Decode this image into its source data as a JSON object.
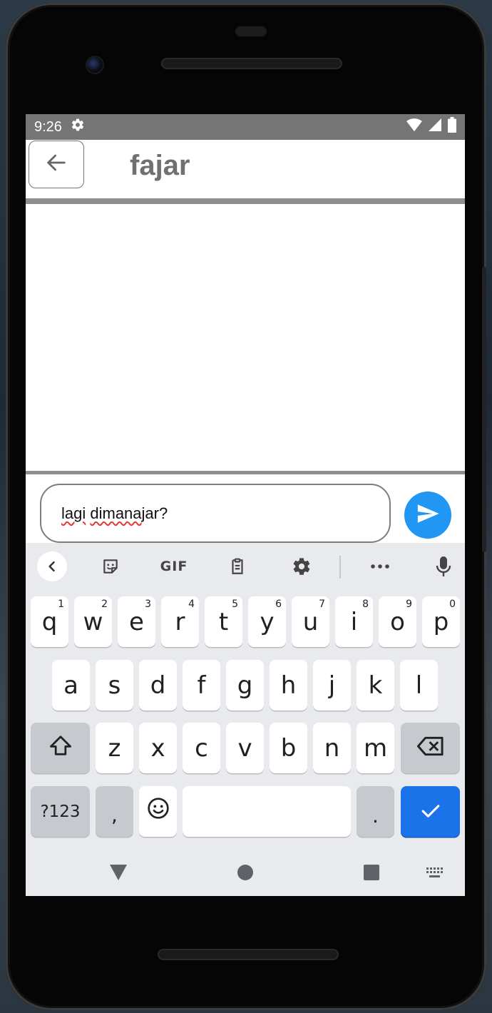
{
  "status_bar": {
    "time": "9:26",
    "settings_icon": "gear-icon",
    "wifi_icon": "wifi-icon",
    "signal_icon": "signal-icon",
    "battery_icon": "battery-icon"
  },
  "app_bar": {
    "back_icon": "arrow-left-icon",
    "title": "fajar"
  },
  "composer": {
    "message_words": [
      "lagi",
      "dimana"
    ],
    "message_rest": " jar?",
    "send_icon": "send-icon"
  },
  "keyboard": {
    "toolbar": {
      "collapse_icon": "chevron-left-icon",
      "sticker_icon": "sticker-icon",
      "gif_label": "GIF",
      "clipboard_icon": "clipboard-icon",
      "settings_icon": "gear-icon",
      "more_icon": "more-dots-icon",
      "mic_icon": "microphone-icon"
    },
    "row1": [
      {
        "key": "q",
        "hint": "1"
      },
      {
        "key": "w",
        "hint": "2"
      },
      {
        "key": "e",
        "hint": "3"
      },
      {
        "key": "r",
        "hint": "4"
      },
      {
        "key": "t",
        "hint": "5"
      },
      {
        "key": "y",
        "hint": "6"
      },
      {
        "key": "u",
        "hint": "7"
      },
      {
        "key": "i",
        "hint": "8"
      },
      {
        "key": "o",
        "hint": "9"
      },
      {
        "key": "p",
        "hint": "0"
      }
    ],
    "row2": [
      "a",
      "s",
      "d",
      "f",
      "g",
      "h",
      "j",
      "k",
      "l"
    ],
    "row3": [
      "z",
      "x",
      "c",
      "v",
      "b",
      "n",
      "m"
    ],
    "shift_icon": "shift-icon",
    "backspace_icon": "backspace-icon",
    "symbols_label": "?123",
    "comma_label": ",",
    "emoji_icon": "emoji-icon",
    "period_label": ".",
    "enter_icon": "checkmark-icon"
  },
  "nav_bar": {
    "back_icon": "triangle-back-icon",
    "home_icon": "circle-home-icon",
    "recents_icon": "square-recents-icon",
    "keyboard_switch_icon": "keyboard-icon"
  },
  "colors": {
    "status_bar": "#757575",
    "send_button": "#2196f3",
    "enter_key": "#1a73e8",
    "spell_error": "#e53935"
  }
}
